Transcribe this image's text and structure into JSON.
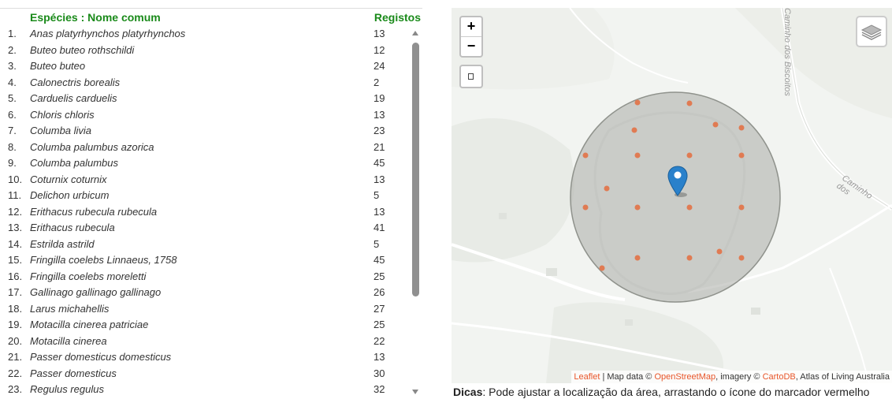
{
  "table": {
    "header_species": "Espécies : Nome comum",
    "header_count": "Registos",
    "rows": [
      {
        "idx": "1.",
        "name": "Anas platyrhynchos platyrhynchos",
        "count": "13"
      },
      {
        "idx": "2.",
        "name": "Buteo buteo rothschildi",
        "count": "12"
      },
      {
        "idx": "3.",
        "name": "Buteo buteo",
        "count": "24"
      },
      {
        "idx": "4.",
        "name": "Calonectris borealis",
        "count": "2"
      },
      {
        "idx": "5.",
        "name": "Carduelis carduelis",
        "count": "19"
      },
      {
        "idx": "6.",
        "name": "Chloris chloris",
        "count": "13"
      },
      {
        "idx": "7.",
        "name": "Columba livia",
        "count": "23"
      },
      {
        "idx": "8.",
        "name": "Columba palumbus azorica",
        "count": "21"
      },
      {
        "idx": "9.",
        "name": "Columba palumbus",
        "count": "45"
      },
      {
        "idx": "10.",
        "name": "Coturnix coturnix",
        "count": "13"
      },
      {
        "idx": "11.",
        "name": "Delichon urbicum",
        "count": "5"
      },
      {
        "idx": "12.",
        "name": "Erithacus rubecula rubecula",
        "count": "13"
      },
      {
        "idx": "13.",
        "name": "Erithacus rubecula",
        "count": "41"
      },
      {
        "idx": "14.",
        "name": "Estrilda astrild",
        "count": "5"
      },
      {
        "idx": "15.",
        "name": "Fringilla coelebs Linnaeus, 1758",
        "count": "45"
      },
      {
        "idx": "16.",
        "name": "Fringilla coelebs moreletti",
        "count": "25"
      },
      {
        "idx": "17.",
        "name": "Gallinago gallinago gallinago",
        "count": "26"
      },
      {
        "idx": "18.",
        "name": "Larus michahellis",
        "count": "27"
      },
      {
        "idx": "19.",
        "name": "Motacilla cinerea patriciae",
        "count": "25"
      },
      {
        "idx": "20.",
        "name": "Motacilla cinerea",
        "count": "22"
      },
      {
        "idx": "21.",
        "name": "Passer domesticus domesticus",
        "count": "13"
      },
      {
        "idx": "22.",
        "name": "Passer domesticus",
        "count": "30"
      },
      {
        "idx": "23.",
        "name": "Regulus regulus",
        "count": "32"
      }
    ]
  },
  "map": {
    "zoom_in": "+",
    "zoom_out": "−",
    "road_label_1": "Caminho dos Biscoitos",
    "road_label_2": "Caminho dos",
    "attribution": {
      "leaflet": "Leaflet",
      "sep1": " | Map data © ",
      "osm": "OpenStreetMap",
      "sep2": ", imagery © ",
      "carto": "CartoDB",
      "rest": ", Atlas of Living Australia"
    },
    "colors": {
      "header_green": "#1a8a1a",
      "record_dot": "#e07b53",
      "marker_blue": "#2a81cb",
      "circle_fill": "#a9aca6",
      "link_orange": "#e8562a"
    }
  },
  "tips": {
    "label": "Dicas",
    "text": ": Pode ajustar a localização da área, arrastando o ícone do marcador vermelho"
  }
}
